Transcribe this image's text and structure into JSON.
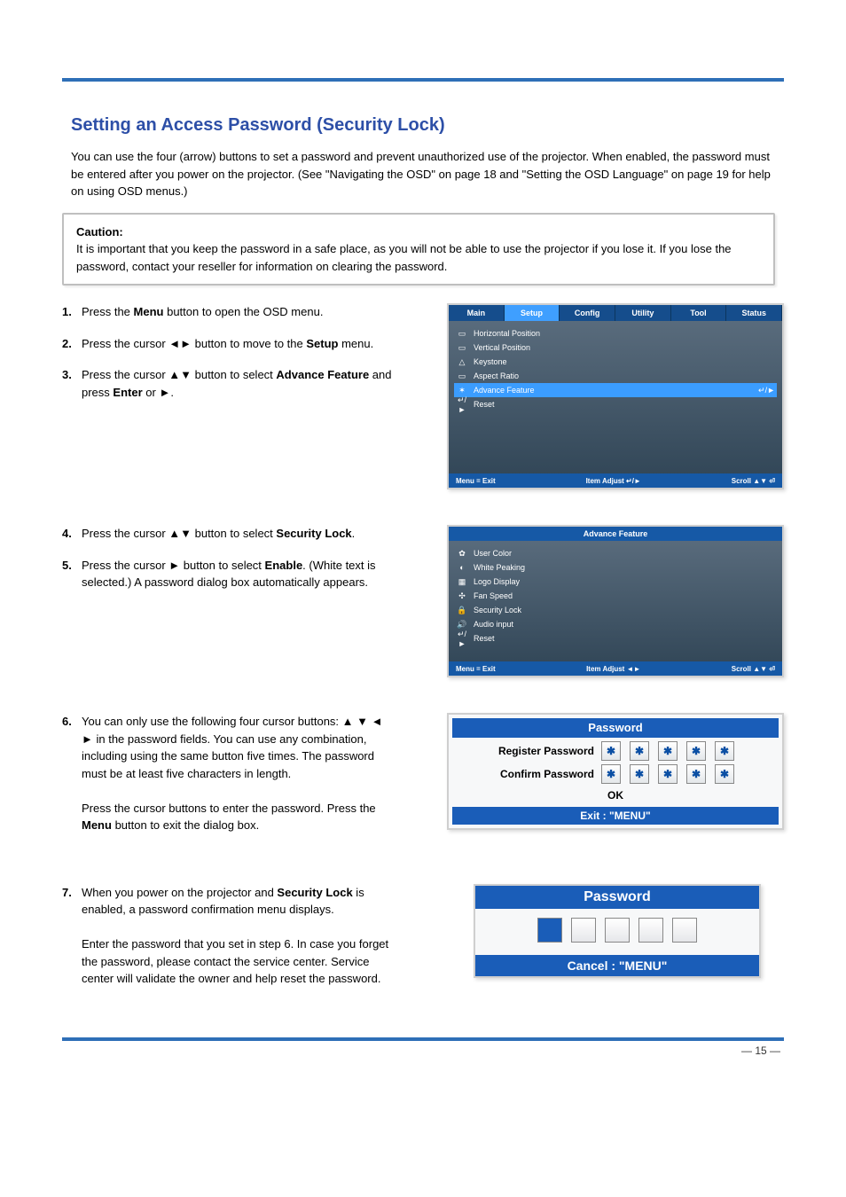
{
  "heading": "Setting an Access Password (Security Lock)",
  "intro": "You can use the four (arrow) buttons to set a password and prevent unauthorized use of the projector. When enabled, the password must be entered after you power on the projector. (See \"Navigating the OSD\" on page 18 and \"Setting the OSD Language\" on page 19 for help on using OSD menus.)",
  "caution": {
    "title": "Caution:",
    "body": "It is important that you keep the password in a safe place, as you will not be able to use the projector if you lose it. If you lose the password, contact your reseller for information on clearing the password."
  },
  "steps": [
    {
      "num": "1.",
      "lines": [
        "Press the <b>Menu</b> button to open the OSD menu."
      ]
    },
    {
      "num": "2.",
      "lines": [
        "Press the cursor <span class='arrow-glyph'>◄►</span> button to move to the <b>Setup</b> menu."
      ]
    },
    {
      "num": "3.",
      "lines": [
        "Press the cursor <span class='arrow-glyph'>▲▼</span> button to select <b>Advance Feature</b> and press <b>Enter</b> or <span class='arrow-glyph'>►</span>."
      ]
    },
    {
      "num": "4.",
      "lines": [
        "Press the cursor <span class='arrow-glyph'>▲▼</span> button to select <b>Security Lock</b>."
      ]
    },
    {
      "num": "5.",
      "lines": [
        "Press the cursor <span class='arrow-glyph'>►</span> button to select <b>Enable</b>. (White text is selected.) A password dialog box automatically appears."
      ]
    },
    {
      "num": "6.",
      "lines": [
        "You can only use the following four cursor buttons: <span class='arrow-glyph'>▲ ▼ ◄ ►</span> in the password fields. You can use any combination, including using the same button five times. The password must be at least five characters in length.",
        "Press the cursor buttons to enter the password. Press the <b>Menu</b> button to exit the dialog box."
      ]
    },
    {
      "num": "7.",
      "lines": [
        "When you power on the projector and <b>Security Lock</b> is enabled, a password confirmation menu displays.",
        "Enter the password that you set in step 6. In case you forget the password, please contact the service center. Service center will validate the owner and help reset the password."
      ]
    }
  ],
  "fig1": {
    "tabs": [
      "Main",
      "Setup",
      "Config",
      "Utility",
      "Tool",
      "Status"
    ],
    "selectedTab": "Setup",
    "rows": [
      {
        "icon": "▭",
        "label": "Horizontal Position"
      },
      {
        "icon": "▭",
        "label": "Vertical Position"
      },
      {
        "icon": "△",
        "label": "Keystone"
      },
      {
        "icon": "▭",
        "label": "Aspect Ratio"
      },
      {
        "icon": "✶",
        "label": "Advance Feature",
        "sel": true,
        "right": "↵/►"
      },
      {
        "icon": "↵/►",
        "label": "Reset"
      }
    ],
    "footer": {
      "left": "Menu = Exit",
      "mid": "Item Adjust   ↵/►",
      "right": "Scroll   ▲▼  ⏎"
    }
  },
  "fig2": {
    "title": "Advance Feature",
    "rows": [
      {
        "icon": "✿",
        "label": "User Color"
      },
      {
        "icon": "◐",
        "label": "White Peaking"
      },
      {
        "icon": "▦",
        "label": "Logo Display"
      },
      {
        "icon": "✣",
        "label": "Fan Speed"
      },
      {
        "icon": "🔒",
        "label": "Security Lock"
      },
      {
        "icon": "🔊",
        "label": "Audio input"
      },
      {
        "icon": "↵/►",
        "label": "Reset"
      }
    ],
    "footer": {
      "left": "Menu = Exit",
      "mid": "Item Adjust   ◄►",
      "right": "Scroll   ▲▼  ⏎"
    }
  },
  "fig3": {
    "title": "Password",
    "register": "Register Password",
    "confirm": "Confirm Password",
    "ok": "OK",
    "exit": "Exit   :   \"MENU\"",
    "mask": "✱"
  },
  "fig4": {
    "title": "Password",
    "cancel": "Cancel   :   \"MENU\""
  },
  "pageNumber": "— 15 —"
}
